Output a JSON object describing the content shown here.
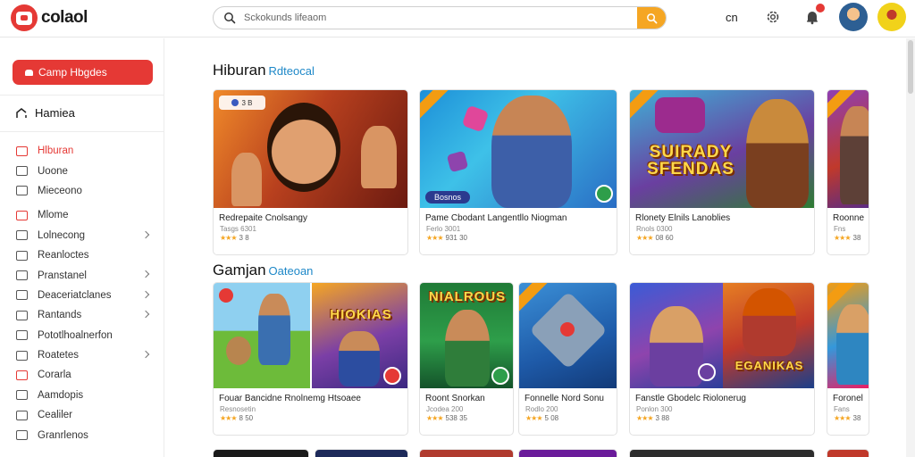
{
  "app": {
    "brand": "colaol"
  },
  "search": {
    "placeholder": "Sckokunds lifeaom"
  },
  "topbar": {
    "lang": "cn"
  },
  "sidebar": {
    "cta_label": "Camp Hbgdes",
    "home_label": "Hamiea",
    "items": [
      {
        "label": "Hlburan",
        "active": true,
        "chevron": false
      },
      {
        "label": "Uoone",
        "active": false,
        "chevron": false
      },
      {
        "label": "Mieceono",
        "active": false,
        "chevron": false
      },
      {
        "label": "Mlome",
        "active": false,
        "chevron": false
      },
      {
        "label": "Lolnecong",
        "active": false,
        "chevron": true
      },
      {
        "label": "Reanloctes",
        "active": false,
        "chevron": false
      },
      {
        "label": "Pranstanel",
        "active": false,
        "chevron": true
      },
      {
        "label": "Deaceriatclanes",
        "active": false,
        "chevron": true
      },
      {
        "label": "Rantands",
        "active": false,
        "chevron": true
      },
      {
        "label": "Pototlhoalnerfon",
        "active": false,
        "chevron": false
      },
      {
        "label": "Roatetes",
        "active": false,
        "chevron": true
      },
      {
        "label": "Corarla",
        "active": false,
        "chevron": false
      },
      {
        "label": "Aamdopis",
        "active": false,
        "chevron": false
      },
      {
        "label": "Cealiler",
        "active": false,
        "chevron": false
      },
      {
        "label": "Granrlenos",
        "active": false,
        "chevron": false
      }
    ]
  },
  "sections": [
    {
      "title": "Hiburan",
      "subtitle": "Rdteocal",
      "cards": [
        {
          "title": "Redrepaite Cnolsangy",
          "meta": "Tasgs 6301",
          "rating": "3 8",
          "stars": "★★★",
          "chip": "3 B"
        },
        {
          "title": "Pame Cbodant Langentllo Niogman",
          "meta": "Ferlo 3001",
          "rating": "931 30",
          "stars": "★★★",
          "label": "Bosnos"
        },
        {
          "title": "Rlonety Elnils Lanoblies",
          "meta": "Rnols 0300",
          "rating": "08 60",
          "stars": "★★★",
          "thumb_text": "SUIRADY SFENDAS"
        },
        {
          "title": "Roonne",
          "meta": "Fns",
          "rating": "38",
          "stars": "★★★"
        }
      ]
    },
    {
      "title": "Gamjan",
      "subtitle": "Oateoan",
      "cards": [
        {
          "title": "Fouar Bancidne Rnolnemg Htsoaee",
          "meta": "Resnosetin",
          "rating": "8 50",
          "stars": "★★★",
          "thumb_text": "HIOKIAS"
        },
        {
          "title": "Roont Snorkan",
          "meta": "Jcodea 200",
          "rating": "538 35",
          "stars": "★★★",
          "thumb_text": "NIALROUS"
        },
        {
          "title": "Fonnelle Nord Sonu",
          "meta": "Rodlo 200",
          "rating": "5 08",
          "stars": "★★★"
        },
        {
          "title": "Fanstle Gbodelc Riolonerug",
          "meta": "Ponlon 300",
          "rating": "3 88",
          "stars": "★★★",
          "thumb_text": "EGANIKAS"
        },
        {
          "title": "Foronel",
          "meta": "Fans",
          "rating": "38",
          "stars": "★★★"
        }
      ]
    }
  ]
}
